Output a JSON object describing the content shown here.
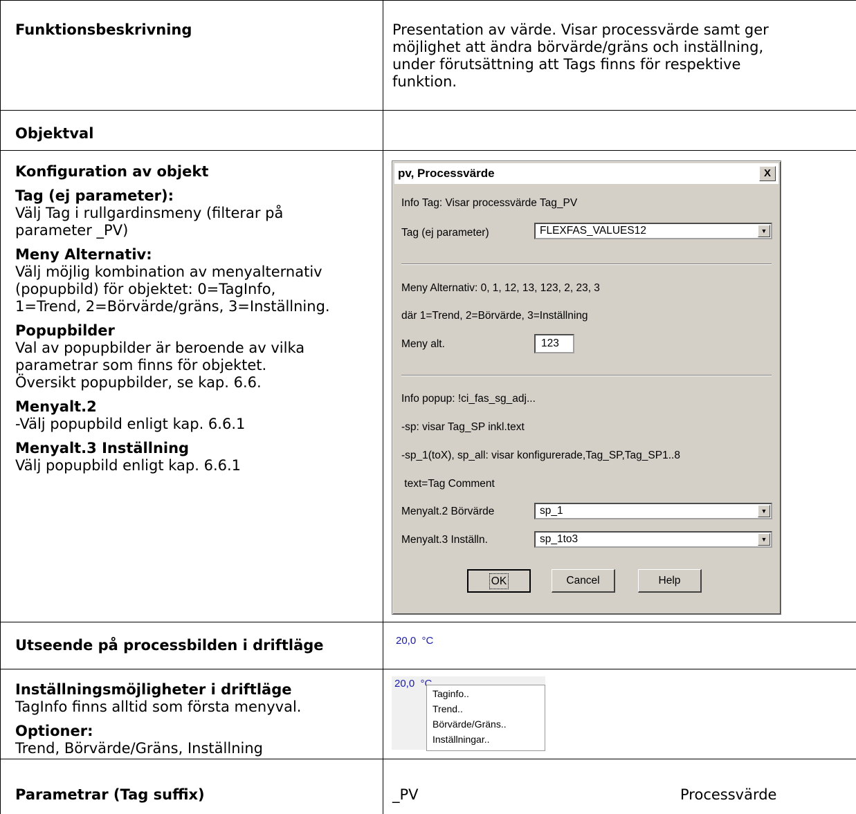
{
  "rows": {
    "funktion": {
      "label": "Funktionsbeskrivning",
      "text_lines": [
        "Presentation av värde.  Visar processvärde samt ger",
        "möjlighet att ändra börvärde/gräns och inställning,",
        "under förutsättning att Tags finns för respektive",
        "funktion."
      ]
    },
    "objektval": {
      "label": "Objektval"
    },
    "konfig": {
      "label": "Konfiguration av objekt",
      "blocks": [
        {
          "heading": "Tag (ej parameter):",
          "lines": [
            "Välj Tag i rullgardinsmeny (filterar på",
            "parameter _PV)"
          ]
        },
        {
          "heading": "Meny Alternativ:",
          "lines": [
            "Välj möjlig kombination av menyalternativ",
            "(popupbild) för objektet: 0=TagInfo,",
            "1=Trend, 2=Börvärde/gräns, 3=Inställning."
          ]
        },
        {
          "heading": "Popupbilder",
          "lines": [
            "Val av popupbilder är beroende av vilka",
            "parametrar som finns för objektet.",
            "Översikt popupbilder, se kap. 6.6."
          ]
        },
        {
          "heading": "Menyalt.2",
          "lines": [
            "-Välj popupbild enligt kap. 6.6.1"
          ]
        },
        {
          "heading": "Menyalt.3 Inställning",
          "lines": [
            "Välj popupbild enligt kap. 6.6.1"
          ]
        }
      ]
    },
    "utseende": {
      "label": "Utseende på processbilden i driftläge",
      "value": "20,0  °C"
    },
    "installning": {
      "label": "Inställningsmöjligheter i driftläge",
      "line1": "TagInfo finns alltid som första menyval.",
      "optioner_heading": "Optioner:",
      "optioner_line": "Trend, Börvärde/Gräns, Inställning",
      "value_partial": "20,0  °C",
      "menu": [
        "Taginfo..",
        "Trend..",
        "Börvärde/Gräns..",
        "Inställningar.."
      ]
    },
    "parametrar": {
      "label": "Parametrar (Tag suffix)",
      "suffix": "_PV",
      "desc": "Processvärde"
    }
  },
  "dialog": {
    "title": "pv, Processvärde",
    "close": "X",
    "info_tag": "Info Tag: Visar processvärde Tag_PV",
    "tag_label": "Tag (ej parameter)",
    "tag_value": "FLEXFAS_VALUES12",
    "meny_alt_info": "Meny Alternativ: 0, 1, 12, 13, 123, 2, 23, 3",
    "dar_info": "där 1=Trend, 2=Börvärde, 3=Inställning",
    "meny_alt_label": "Meny alt.",
    "meny_alt_value": "123",
    "info_popup": "Info popup: !ci_fas_sg_adj...",
    "sp_info": "-sp: visar Tag_SP inkl.text",
    "sp1_info": "-sp_1(toX), sp_all: visar konfigurerade,Tag_SP,Tag_SP1..8",
    "text_info": " text=Tag Comment",
    "menyalt2_label": "Menyalt.2 Börvärde",
    "menyalt2_value": "sp_1",
    "menyalt3_label": "Menyalt.3 Inställn.",
    "menyalt3_value": "sp_1to3",
    "ok": "OK",
    "cancel": "Cancel",
    "help": "Help"
  }
}
